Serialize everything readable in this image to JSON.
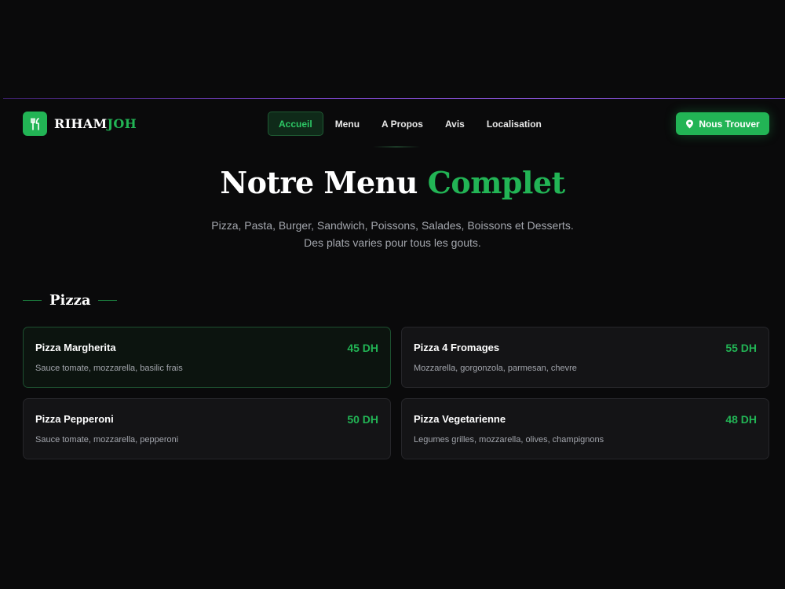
{
  "brand": {
    "name_part1": "RIHAM",
    "name_part2": "JOH",
    "accent": "#22b455"
  },
  "nav": {
    "links": [
      {
        "label": "Accueil",
        "active": true
      },
      {
        "label": "Menu"
      },
      {
        "label": "A Propos"
      },
      {
        "label": "Avis"
      },
      {
        "label": "Localisation"
      }
    ],
    "cta_label": "Nous Trouver",
    "cta_icon": "map-pin-icon"
  },
  "hero": {
    "title_white": "Notre Menu",
    "title_green": "Complet",
    "subtitle_line1": "Pizza, Pasta, Burger, Sandwich, Poissons, Salades, Boissons et Desserts.",
    "subtitle_line2": "Des plats varies pour tous les gouts."
  },
  "section": {
    "title": "Pizza",
    "items": [
      {
        "name": "Pizza Margherita",
        "price": "45 DH",
        "description": "Sauce tomate, mozzarella, basilic frais"
      },
      {
        "name": "Pizza 4 Fromages",
        "price": "55 DH",
        "description": "Mozzarella, gorgonzola, parmesan, chevre"
      },
      {
        "name": "Pizza Pepperoni",
        "price": "50 DH",
        "description": "Sauce tomate, mozzarella, pepperoni"
      },
      {
        "name": "Pizza Vegetarienne",
        "price": "48 DH",
        "description": "Legumes grilles, mozzarella, olives, champignons"
      }
    ]
  }
}
